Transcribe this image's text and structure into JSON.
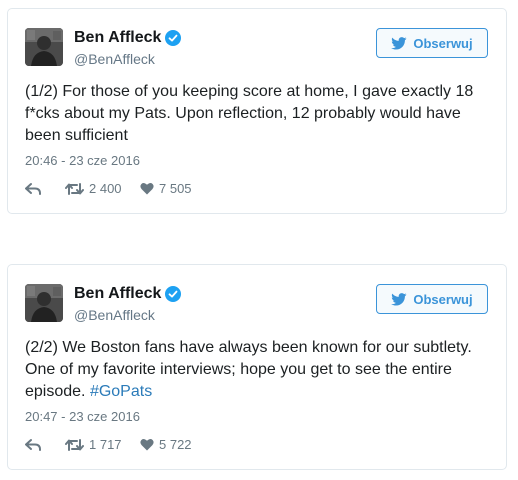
{
  "tweets": [
    {
      "display_name": "Ben Affleck",
      "handle": "@BenAffleck",
      "follow_label": "Obserwuj",
      "text": "(1/2) For those of you keeping score at home, I gave exactly 18 f*cks about my Pats. Upon reflection, 12 probably would have been sufficient",
      "timestamp": "20:46 - 23 cze 2016",
      "retweets": "2 400",
      "likes": "7 505"
    },
    {
      "display_name": "Ben Affleck",
      "handle": "@BenAffleck",
      "follow_label": "Obserwuj",
      "text": "(2/2) We Boston fans have always been known for our subtlety. One of my favorite interviews; hope you get to see the entire episode. ",
      "hashtag": "#GoPats",
      "timestamp": "20:47 - 23 cze 2016",
      "retweets": "1 717",
      "likes": "5 722"
    }
  ],
  "colors": {
    "accent": "#3b94d9",
    "verified": "#1da1f2",
    "muted": "#697882",
    "border": "#e1e8ed",
    "hashtag": "#2b7bb9"
  },
  "icons": [
    "verified-badge-icon",
    "twitter-bird-icon",
    "reply-icon",
    "retweet-icon",
    "heart-icon"
  ]
}
